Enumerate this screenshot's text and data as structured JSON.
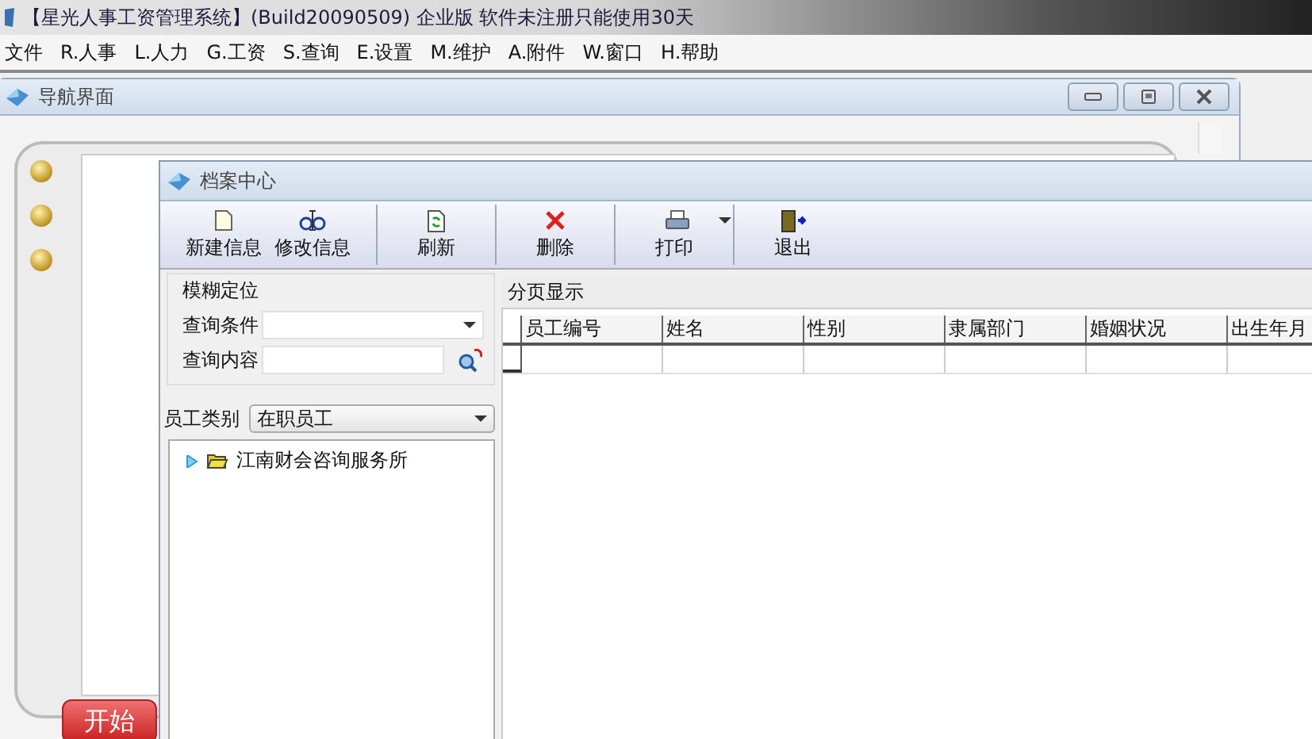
{
  "app_window": {
    "title": "【星光人事工资管理系统】(Build20090509) 企业版 软件未注册只能使用30天"
  },
  "menu": [
    "文件",
    "R.人事",
    "L.人力",
    "G.工资",
    "S.查询",
    "E.设置",
    "M.维护",
    "A.附件",
    "W.窗口",
    "H.帮助"
  ],
  "nav_window": {
    "title": "导航界面",
    "start_button": "开始"
  },
  "archive_window": {
    "title": "档案中心",
    "toolbar": [
      [
        {
          "label": "新建信息",
          "kind": "new"
        },
        {
          "label": "修改信息",
          "kind": "edit"
        }
      ],
      [
        {
          "label": "刷新",
          "kind": "refresh"
        }
      ],
      [
        {
          "label": "删除",
          "kind": "delete"
        }
      ],
      [
        {
          "label": "打印",
          "kind": "print",
          "dropdown": true
        }
      ],
      [
        {
          "label": "退出",
          "kind": "exit"
        }
      ]
    ],
    "search_group": {
      "title": "模糊定位",
      "condition_label": "查询条件",
      "content_label": "查询内容"
    },
    "category": {
      "label": "员工类别",
      "value": "在职员工"
    },
    "tree": [
      {
        "label": "江南财会咨询服务所",
        "expanded": false
      }
    ],
    "grid": {
      "title": "分页显示",
      "columns": [
        "员工编号",
        "姓名",
        "性别",
        "隶属部门",
        "婚姻状况",
        "出生年月"
      ]
    }
  }
}
